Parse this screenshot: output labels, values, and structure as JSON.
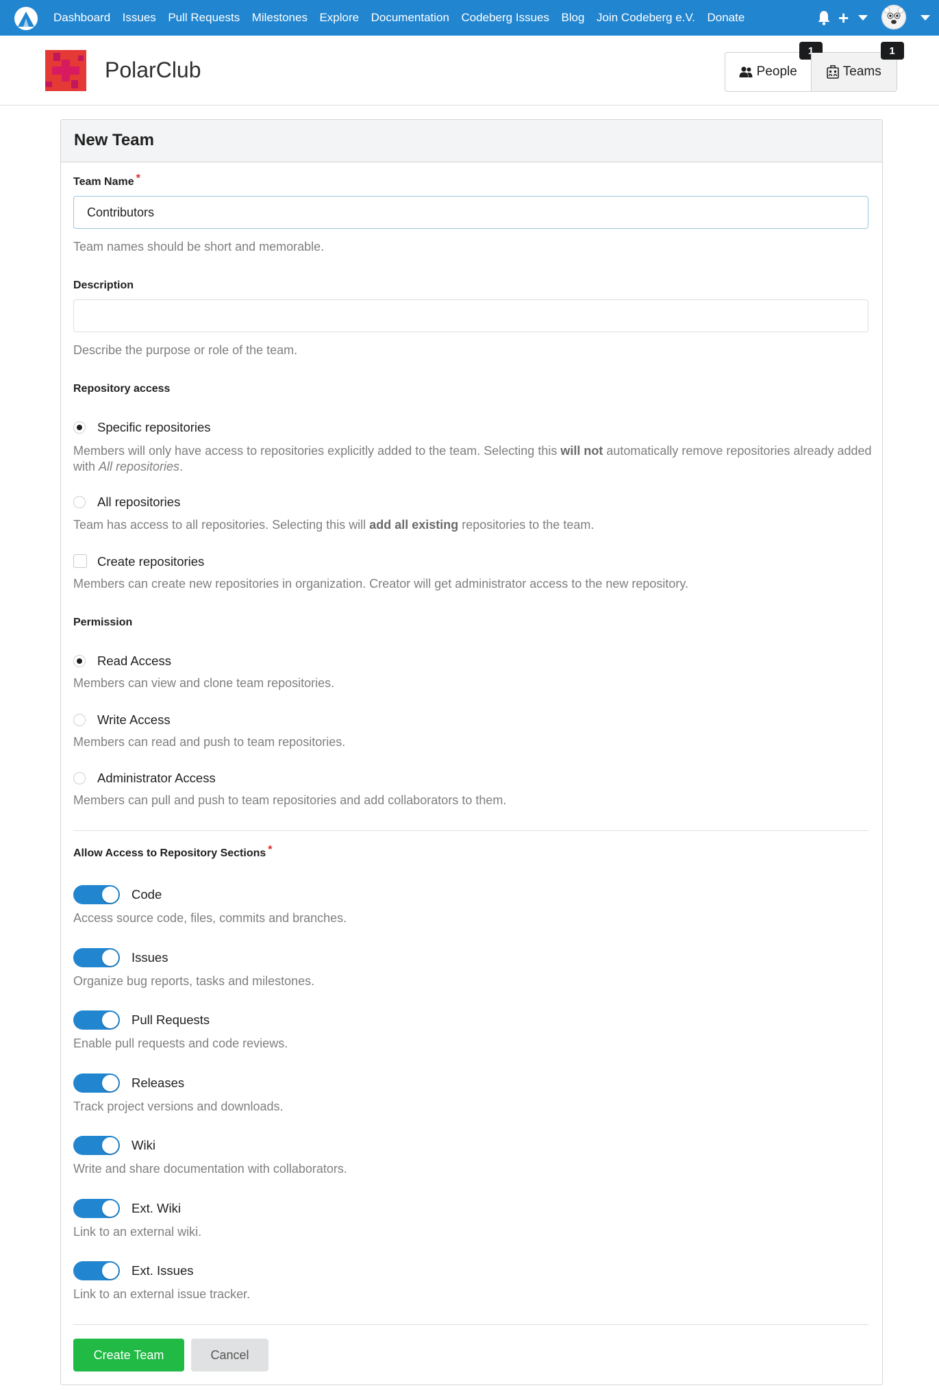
{
  "nav": {
    "links": [
      "Dashboard",
      "Issues",
      "Pull Requests",
      "Milestones",
      "Explore",
      "Documentation",
      "Codeberg Issues",
      "Blog",
      "Join Codeberg e.V.",
      "Donate"
    ],
    "icons": [
      "codeberg-logo",
      "bell-icon",
      "plus-icon",
      "chevron-down-icon",
      "avatar",
      "chevron-down-icon"
    ]
  },
  "org": {
    "name": "PolarClub",
    "tabs": [
      {
        "label": "People",
        "count": "1",
        "icon": "people-icon"
      },
      {
        "label": "Teams",
        "count": "1",
        "icon": "teams-icon",
        "active": true
      }
    ]
  },
  "form": {
    "title": "New Team",
    "team_name": {
      "label": "Team Name",
      "required": true,
      "value": "Contributors",
      "help": "Team names should be short and memorable."
    },
    "description": {
      "label": "Description",
      "value": "",
      "help": "Describe the purpose or role of the team."
    },
    "repository_access": {
      "label": "Repository access",
      "specific": {
        "label": "Specific repositories",
        "selected": true,
        "help_pre": "Members will only have access to repositories explicitly added to the team. Selecting this ",
        "help_bold": "will not",
        "help_mid": " automatically remove repositories already added with ",
        "help_italic": "All repositories",
        "help_end": "."
      },
      "all": {
        "label": "All repositories",
        "selected": false,
        "help_pre": "Team has access to all repositories. Selecting this will ",
        "help_bold": "add all existing",
        "help_end": " repositories to the team."
      },
      "create": {
        "label": "Create repositories",
        "checked": false,
        "help": "Members can create new repositories in organization. Creator will get administrator access to the new repository."
      }
    },
    "permission": {
      "label": "Permission",
      "options": [
        {
          "label": "Read Access",
          "selected": true,
          "help": "Members can view and clone team repositories."
        },
        {
          "label": "Write Access",
          "selected": false,
          "help": "Members can read and push to team repositories."
        },
        {
          "label": "Administrator Access",
          "selected": false,
          "help": "Members can pull and push to team repositories and add collaborators to them."
        }
      ]
    },
    "sections": {
      "label": "Allow Access to Repository Sections",
      "required": true,
      "items": [
        {
          "label": "Code",
          "enabled": true,
          "help": "Access source code, files, commits and branches."
        },
        {
          "label": "Issues",
          "enabled": true,
          "help": "Organize bug reports, tasks and milestones."
        },
        {
          "label": "Pull Requests",
          "enabled": true,
          "help": "Enable pull requests and code reviews."
        },
        {
          "label": "Releases",
          "enabled": true,
          "help": "Track project versions and downloads."
        },
        {
          "label": "Wiki",
          "enabled": true,
          "help": "Write and share documentation with collaborators."
        },
        {
          "label": "Ext. Wiki",
          "enabled": true,
          "help": "Link to an external wiki."
        },
        {
          "label": "Ext. Issues",
          "enabled": true,
          "help": "Link to an external issue tracker."
        }
      ]
    },
    "buttons": {
      "create": "Create Team",
      "cancel": "Cancel"
    }
  },
  "colors": {
    "nav": "#2185d0",
    "toggle": "#2185d0",
    "primary_button": "#21ba45",
    "required": "#db2828"
  }
}
